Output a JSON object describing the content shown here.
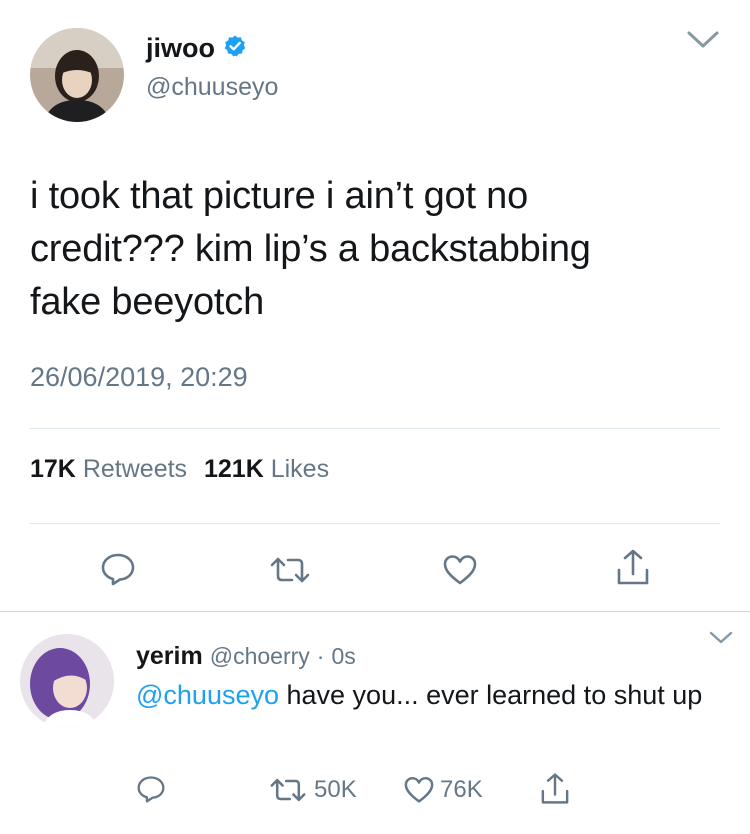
{
  "tweet": {
    "display_name": "jiwoo",
    "verified_icon": "verified-badge-icon",
    "handle": "@chuuseyo",
    "text": "i took that picture i ain’t got no credit??? kim lip’s a backstabbing fake beeyotch",
    "timestamp": "26/06/2019, 20:29",
    "retweet_count": "17K",
    "retweet_label": "Retweets",
    "like_count": "121K",
    "like_label": "Likes",
    "actions": [
      "reply-icon",
      "retweet-icon",
      "like-icon",
      "share-icon"
    ]
  },
  "reply": {
    "display_name": "yerim",
    "handle": "@choerry",
    "separator": "·",
    "time": "0s",
    "mention": "@chuuseyo",
    "text": " have you... ever learned to shut up",
    "retweet_count": "50K",
    "like_count": "76K"
  },
  "colors": {
    "accent": "#1da1f2",
    "secondary_text": "#657786",
    "divider": "#e1e8ed"
  }
}
